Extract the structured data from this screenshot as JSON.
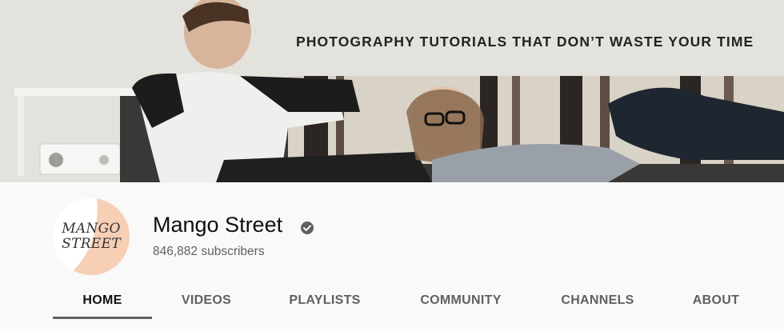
{
  "banner": {
    "tagline": "PHOTOGRAPHY TUTORIALS THAT DON’T WASTE YOUR TIME"
  },
  "channel": {
    "avatar_line1": "MANGO",
    "avatar_line2": "STREET",
    "name": "Mango Street",
    "subscribers": "846,882 subscribers",
    "verified_icon": "verified-check-icon"
  },
  "tabs": [
    {
      "label": "HOME",
      "active": true
    },
    {
      "label": "VIDEOS",
      "active": false
    },
    {
      "label": "PLAYLISTS",
      "active": false
    },
    {
      "label": "COMMUNITY",
      "active": false
    },
    {
      "label": "CHANNELS",
      "active": false
    },
    {
      "label": "ABOUT",
      "active": false
    }
  ],
  "colors": {
    "avatar_accent": "#f6cfb4",
    "text_primary": "#0f0f0f",
    "text_secondary": "#606060",
    "page_bg": "#f9f9f9"
  }
}
